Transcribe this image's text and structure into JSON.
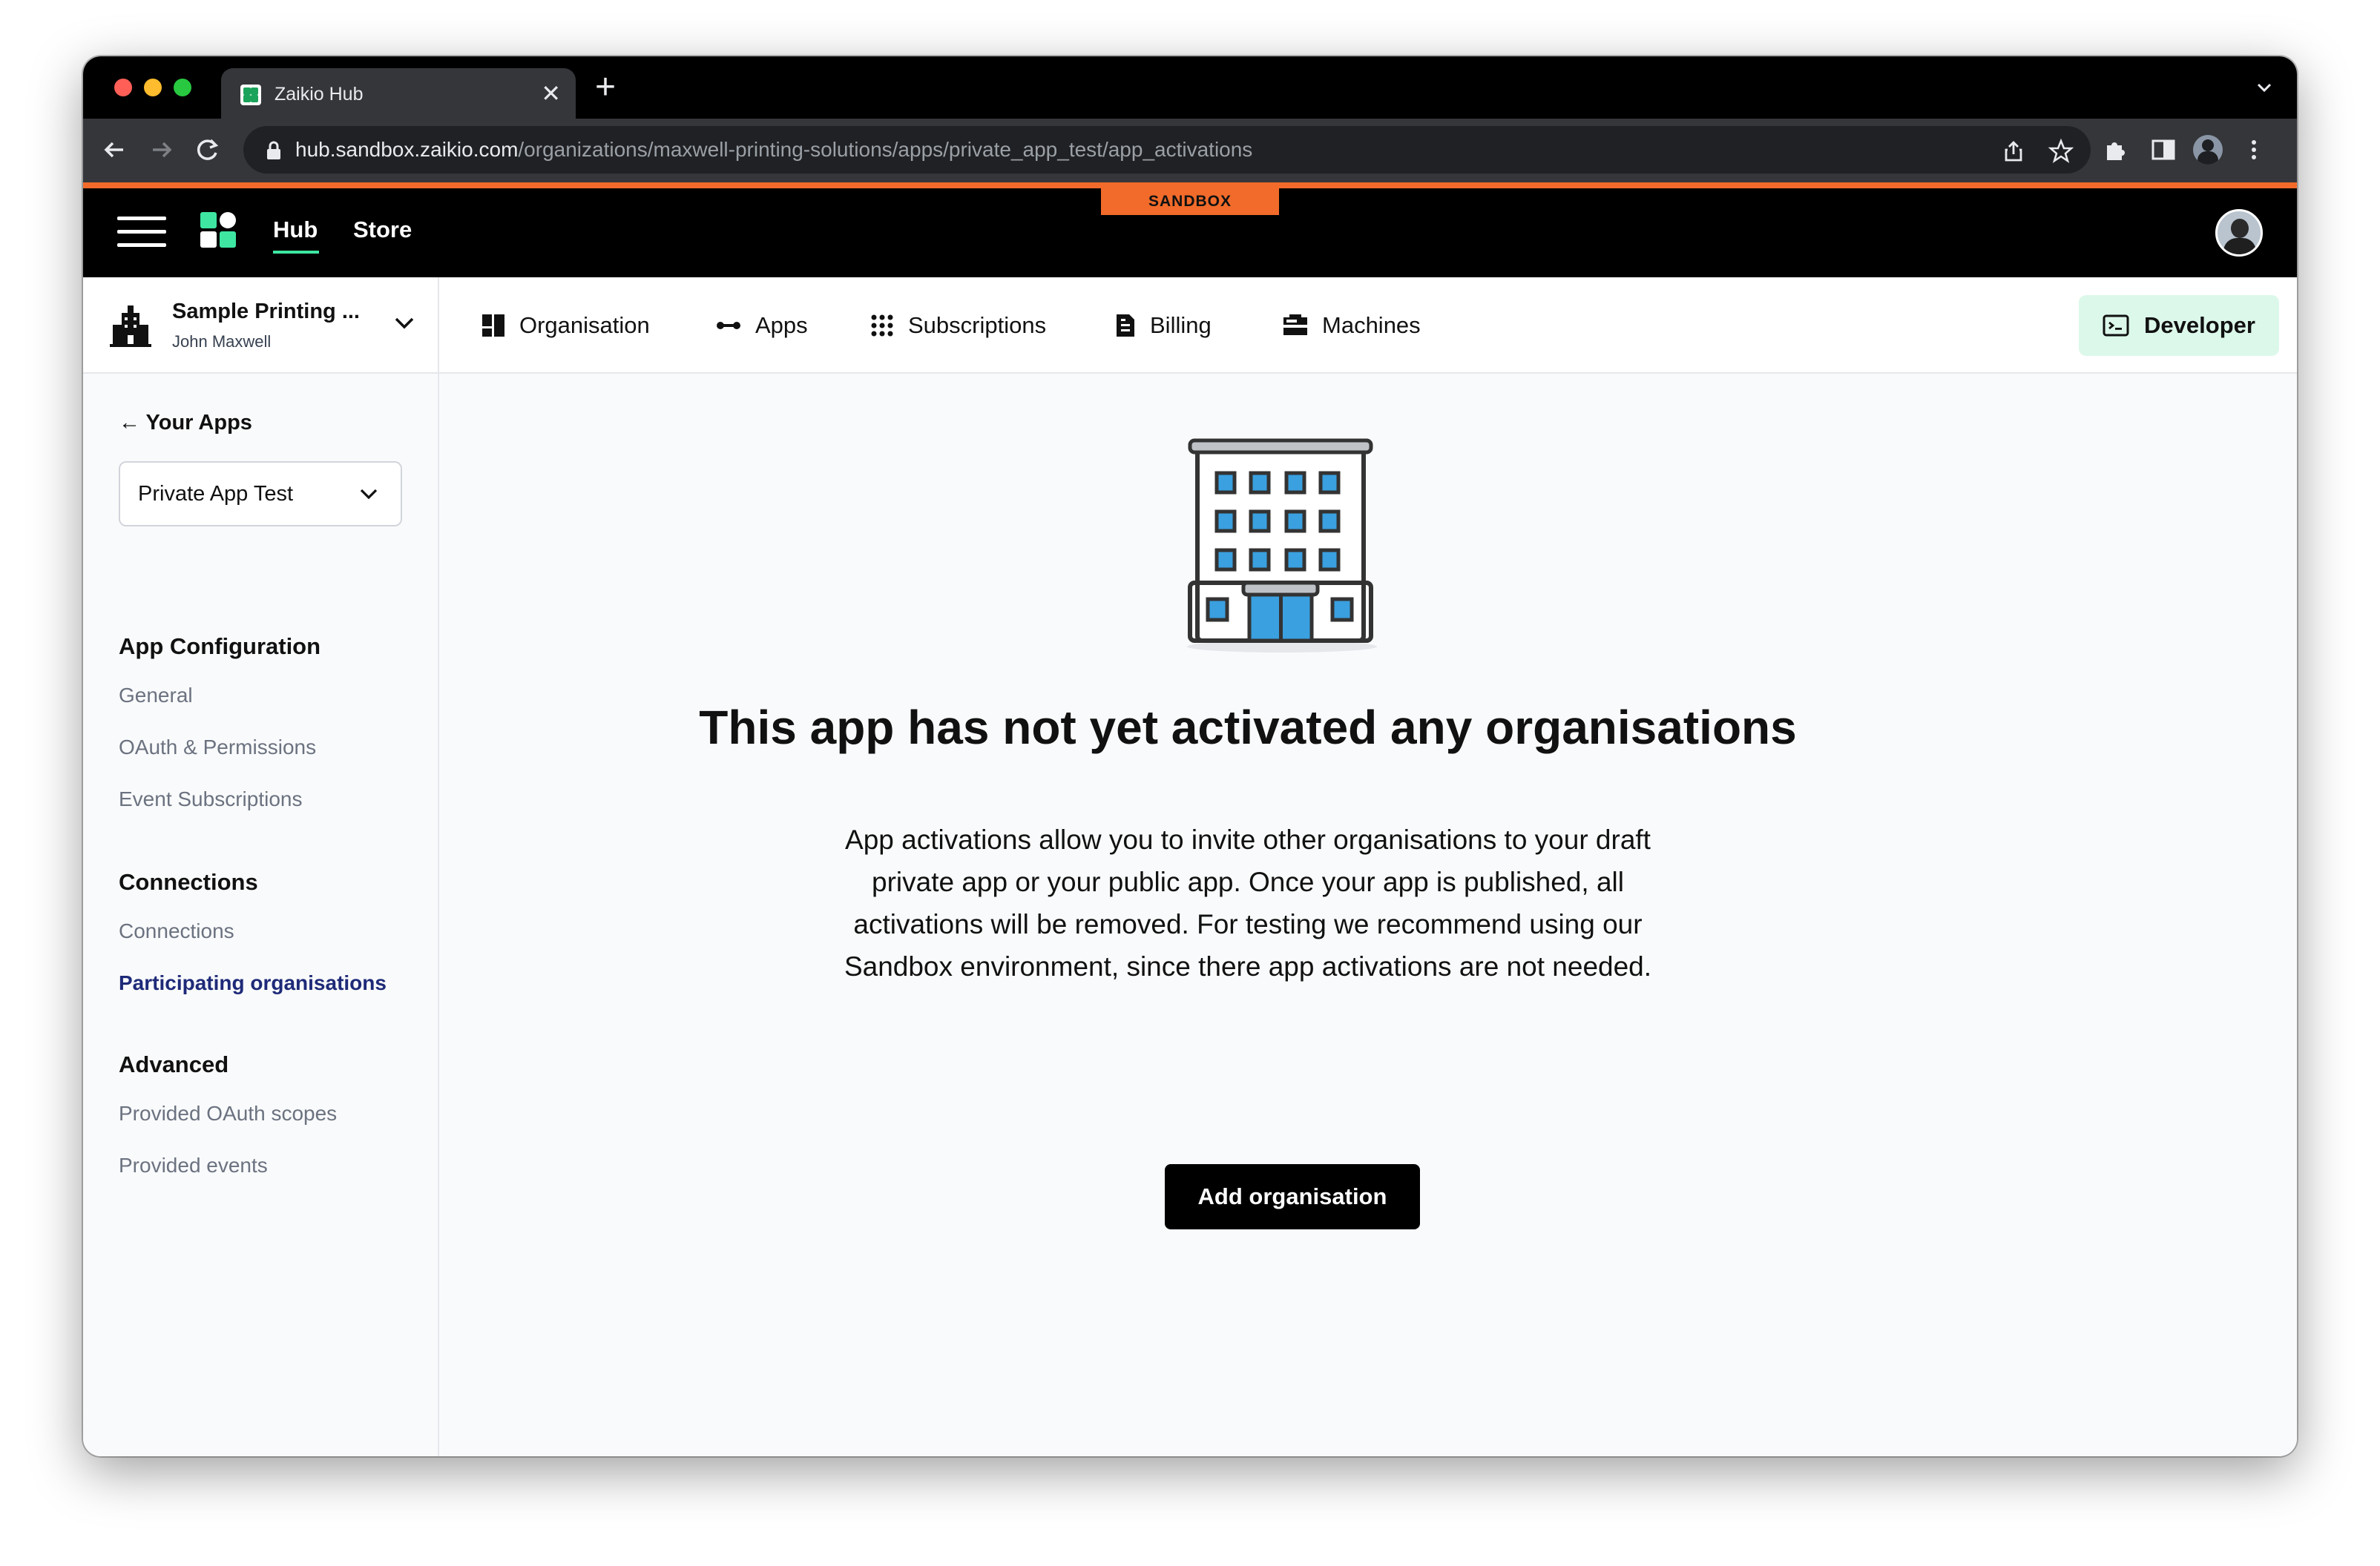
{
  "browser": {
    "tab_title": "Zaikio Hub",
    "url_host": "hub.sandbox.zaikio.com",
    "url_path": "/organizations/maxwell-printing-solutions/apps/private_app_test/app_activations"
  },
  "header": {
    "sandbox_label": "SANDBOX",
    "nav": {
      "hub": "Hub",
      "store": "Store"
    },
    "accent_color": "#f26b2a"
  },
  "org": {
    "name": "Sample Printing ...",
    "user": "John Maxwell"
  },
  "topnav": {
    "items": [
      {
        "label": "Organisation",
        "icon": "organisation-icon"
      },
      {
        "label": "Apps",
        "icon": "apps-icon"
      },
      {
        "label": "Subscriptions",
        "icon": "subscriptions-icon"
      },
      {
        "label": "Billing",
        "icon": "billing-icon"
      },
      {
        "label": "Machines",
        "icon": "machines-icon"
      }
    ],
    "developer_label": "Developer"
  },
  "sidebar": {
    "back_label": "← Your Apps",
    "app_select_value": "Private App Test",
    "sections": [
      {
        "heading": "App Configuration",
        "links": [
          "General",
          "OAuth & Permissions",
          "Event Subscriptions"
        ]
      },
      {
        "heading": "Connections",
        "links": [
          "Connections",
          "Participating organisations"
        ]
      },
      {
        "heading": "Advanced",
        "links": [
          "Provided OAuth scopes",
          "Provided events"
        ]
      }
    ],
    "active_link": "Participating organisations"
  },
  "main": {
    "title": "This app has not yet activated any organisations",
    "description": "App activations allow you to invite other organisations to your draft private app or your public app. Once your app is published, all activations will be removed. For testing we recommend using our Sandbox environment, since there app activations are not needed.",
    "add_button": "Add organisation"
  }
}
